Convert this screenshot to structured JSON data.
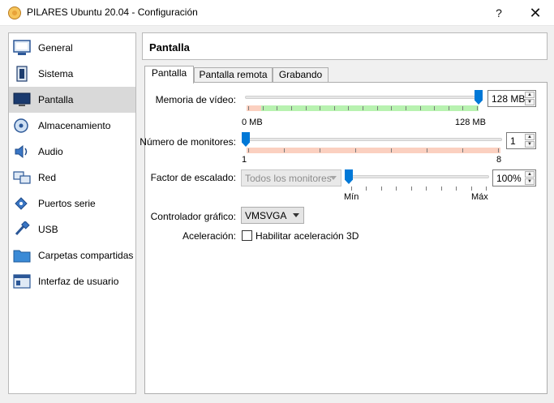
{
  "window": {
    "title": "PILARES Ubuntu 20.04 - Configuración",
    "help_glyph": "?",
    "close_glyph": "✕"
  },
  "sidebar": {
    "items": [
      {
        "label": "General",
        "icon": "general-icon"
      },
      {
        "label": "Sistema",
        "icon": "system-icon"
      },
      {
        "label": "Pantalla",
        "icon": "display-icon",
        "selected": true
      },
      {
        "label": "Almacenamiento",
        "icon": "storage-icon"
      },
      {
        "label": "Audio",
        "icon": "audio-icon"
      },
      {
        "label": "Red",
        "icon": "network-icon"
      },
      {
        "label": "Puertos serie",
        "icon": "serial-ports-icon"
      },
      {
        "label": "USB",
        "icon": "usb-icon"
      },
      {
        "label": "Carpetas compartidas",
        "icon": "shared-folders-icon"
      },
      {
        "label": "Interfaz de usuario",
        "icon": "user-interface-icon"
      }
    ]
  },
  "page": {
    "title": "Pantalla"
  },
  "tabs": [
    {
      "label": "Pantalla",
      "active": true
    },
    {
      "label": "Pantalla remota",
      "active": false
    },
    {
      "label": "Grabando",
      "active": false
    }
  ],
  "video_memory": {
    "label": "Memoria de vídeo:",
    "value": "128 MB",
    "fraction": 1.0,
    "min_label": "0 MB",
    "max_label": "128 MB"
  },
  "monitors": {
    "label": "Número de monitores:",
    "value": "1",
    "fraction": 0.0,
    "min_label": "1",
    "max_label": "8"
  },
  "scale": {
    "label": "Factor de escalado:",
    "combo_value": "Todos los monitores",
    "value": "100%",
    "fraction": 0.0,
    "min_label": "Mín",
    "max_label": "Máx"
  },
  "controller": {
    "label": "Controlador gráfico:",
    "value": "VMSVGA"
  },
  "acceleration": {
    "label": "Aceleración:",
    "checkbox_label": "Habilitar aceleración 3D",
    "checked": false
  },
  "colors": {
    "accent": "#0078d7",
    "safe_range": "#b8f2b0",
    "warn_range": "#fbd0c0",
    "selected_item": "#d9d9d9"
  }
}
